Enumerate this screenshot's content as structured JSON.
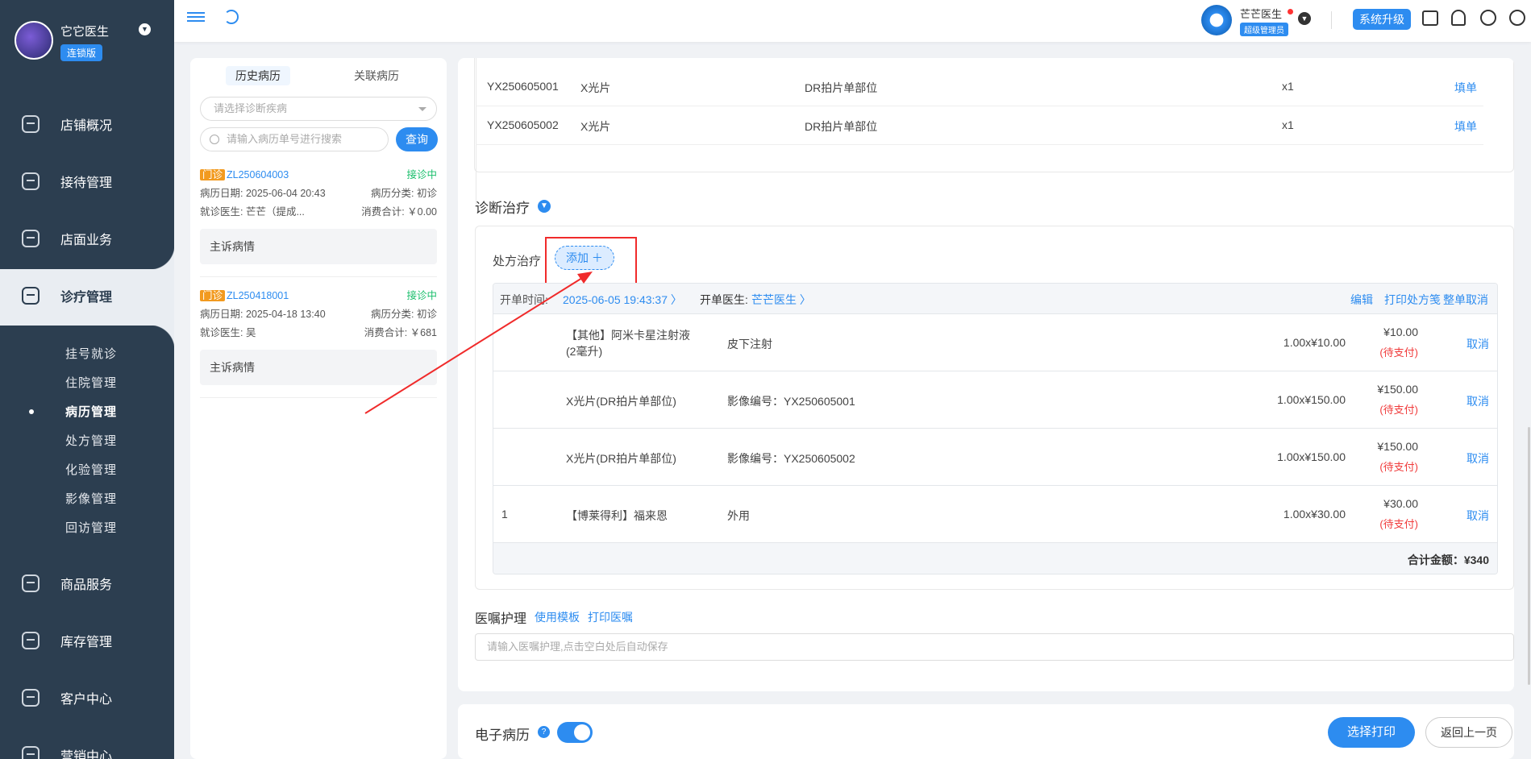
{
  "sidebar": {
    "clinic_name": "它它医生",
    "edition": "连锁版",
    "nav": [
      {
        "label": "店铺概况"
      },
      {
        "label": "接待管理"
      },
      {
        "label": "店面业务"
      },
      {
        "label": "诊疗管理"
      },
      {
        "label": "商品服务"
      },
      {
        "label": "库存管理"
      },
      {
        "label": "客户中心"
      },
      {
        "label": "营销中心"
      }
    ],
    "sub_items": [
      "挂号就诊",
      "住院管理",
      "病历管理",
      "处方管理",
      "化验管理",
      "影像管理",
      "回访管理"
    ]
  },
  "topbar": {
    "user_name": "芒芒医生",
    "user_role": "超级管理员",
    "upgrade_label": "系统升级"
  },
  "history": {
    "tabs": [
      "历史病历",
      "关联病历"
    ],
    "diagnosis_placeholder": "请选择诊断疾病",
    "search_placeholder": "请输入病历单号进行搜索",
    "query_label": "查询",
    "records": [
      {
        "type": "门诊",
        "id": "ZL250604003",
        "status": "接诊中",
        "date": "病历日期: 2025-06-04 20:43",
        "category": "病历分类: 初诊",
        "doctor": "就诊医生: 芒芒（提成...",
        "spend": "消费合计: ￥0.00",
        "complaint": "主诉病情"
      },
      {
        "type": "门诊",
        "id": "ZL250418001",
        "status": "接诊中",
        "date": "病历日期: 2025-04-18 13:40",
        "category": "病历分类: 初诊",
        "doctor": "就诊医生: 吴",
        "spend": "消费合计: ￥681",
        "complaint": "主诉病情"
      }
    ]
  },
  "imaging_rows": [
    {
      "code": "YX250605001",
      "type": "X光片",
      "part": "DR拍片单部位",
      "qty": "x1",
      "action": "填单"
    },
    {
      "code": "YX250605002",
      "type": "X光片",
      "part": "DR拍片单部位",
      "qty": "x1",
      "action": "填单"
    }
  ],
  "diagnosis": {
    "title": "诊断治疗",
    "rx_label": "处方治疗",
    "add_label": "添加 ＋",
    "time_label": "开单时间:",
    "time_value": "2025-06-05 19:43:37 〉",
    "doctor_label": "开单医生:",
    "doctor_value": "芒芒医生 〉",
    "actions": [
      "编辑",
      "打印处方笺",
      "整单取消"
    ],
    "rows": [
      {
        "no": "",
        "name": "【其他】阿米卡星注射液(2毫升)",
        "usage": "皮下注射",
        "qty_price": "1.00x¥10.00",
        "amount": "¥10.00",
        "status": "(待支付)",
        "action": "取消"
      },
      {
        "no": "",
        "name": "X光片(DR拍片单部位)",
        "usage": "影像编号：YX250605001",
        "qty_price": "1.00x¥150.00",
        "amount": "¥150.00",
        "status": "(待支付)",
        "action": "取消"
      },
      {
        "no": "",
        "name": "X光片(DR拍片单部位)",
        "usage": "影像编号：YX250605002",
        "qty_price": "1.00x¥150.00",
        "amount": "¥150.00",
        "status": "(待支付)",
        "action": "取消"
      },
      {
        "no": "1",
        "name": "【博莱得利】福来恩",
        "usage": "外用",
        "qty_price": "1.00x¥30.00",
        "amount": "¥30.00",
        "status": "(待支付)",
        "action": "取消"
      }
    ],
    "total": "合计金额：¥340"
  },
  "advice": {
    "label": "医嘱护理",
    "template_link": "使用模板",
    "print_link": "打印医嘱",
    "placeholder": "请输入医嘱护理,点击空白处后自动保存"
  },
  "footer": {
    "emr_label": "电子病历",
    "help": "?",
    "print_label": "选择打印",
    "back_label": "返回上一页"
  },
  "colors": {
    "accent": "#2d8cf0",
    "sidebar": "#2c3e50",
    "annotation": "#f02b2b"
  }
}
